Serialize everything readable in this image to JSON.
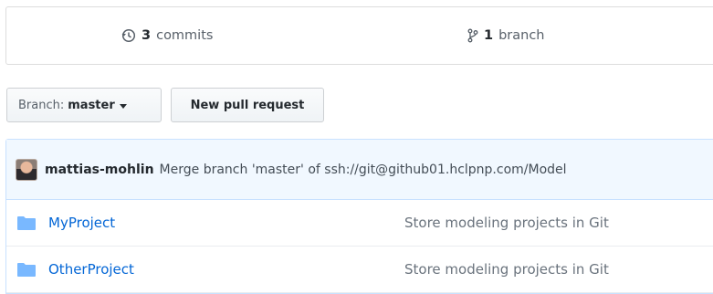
{
  "summary": {
    "commits_count": "3",
    "commits_label": "commits",
    "branches_count": "1",
    "branches_label": "branch"
  },
  "toolbar": {
    "branch_label": "Branch:",
    "branch_value": "master",
    "new_pr_label": "New pull request"
  },
  "latest_commit": {
    "author": "mattias-mohlin",
    "message": "Merge branch 'master' of ssh://git@github01.hclpnp.com/Model"
  },
  "files": [
    {
      "name": "MyProject",
      "message": "Store modeling projects in Git",
      "icon": "folder-icon"
    },
    {
      "name": "OtherProject",
      "message": "Store modeling projects in Git",
      "icon": "folder-icon"
    }
  ],
  "colors": {
    "link": "#0366d6",
    "folder": "#79b8ff",
    "commit_bar_bg": "#f1f8ff"
  }
}
